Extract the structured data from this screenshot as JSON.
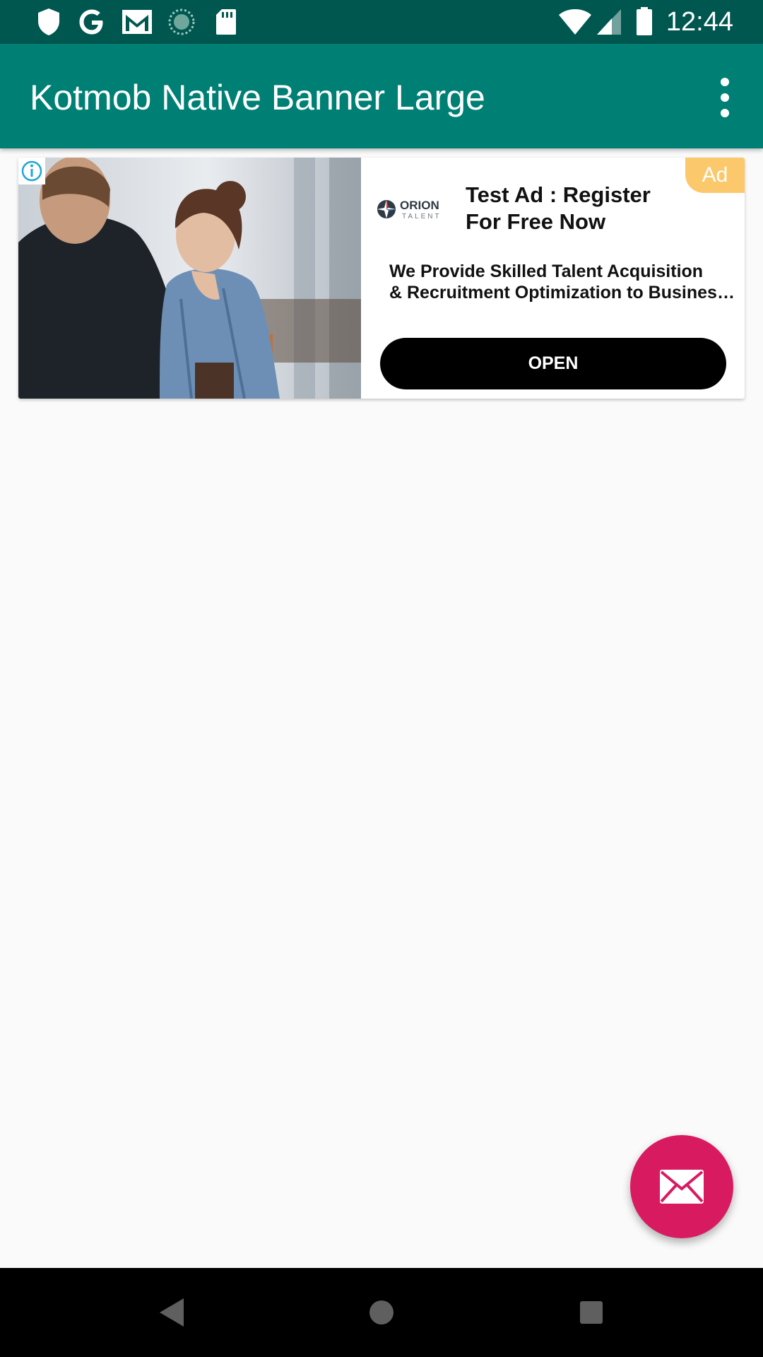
{
  "status_bar": {
    "time": "12:44",
    "left_icons": [
      "shield-icon",
      "google-icon",
      "gmail-icon",
      "sync-icon",
      "sd-card-icon"
    ],
    "right_icons": [
      "wifi-icon",
      "signal-icon",
      "battery-icon"
    ]
  },
  "app_bar": {
    "title": "Kotmob Native Banner Large",
    "menu_icon": "more-vert-icon"
  },
  "ad": {
    "badge": "Ad",
    "headline": "Test Ad : Register For Free Now",
    "body_line1": "We Provide Skilled Talent Acquisition",
    "body_line2": "& Recruitment Optimization to Business…",
    "cta": "OPEN",
    "advertiser_logo": {
      "name": "ORION",
      "sub": "TALENT"
    },
    "info_icon": "info-icon"
  },
  "fab": {
    "icon": "mail-icon",
    "color": "#d81b60"
  },
  "colors": {
    "status_bar": "#00574f",
    "app_bar": "#008074",
    "background": "#fafafa",
    "ad_badge": "#fbc96b"
  },
  "nav_bar": {
    "buttons": [
      "back-icon",
      "home-icon",
      "recents-icon"
    ]
  }
}
